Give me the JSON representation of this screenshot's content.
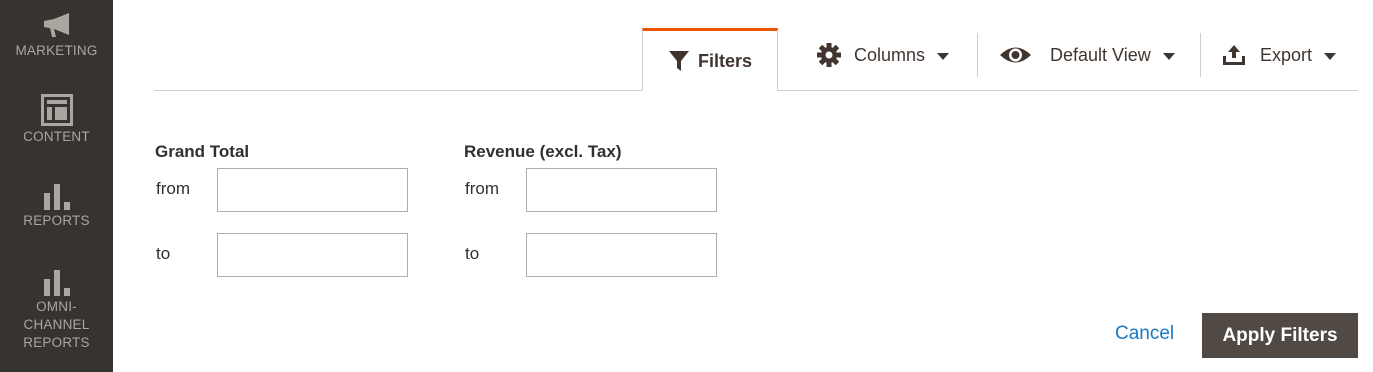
{
  "sidebar": {
    "items": [
      {
        "label": "MARKETING",
        "icon": "megaphone-icon"
      },
      {
        "label": "CONTENT",
        "icon": "content-layout-icon"
      },
      {
        "label": "REPORTS",
        "icon": "bar-chart-icon"
      },
      {
        "label": "OMNI-\nCHANNEL\nREPORTS",
        "icon": "bar-chart-icon"
      }
    ]
  },
  "toolbar": {
    "filters_label": "Filters",
    "columns_label": "Columns",
    "view_label": "Default View",
    "export_label": "Export",
    "active_accent": "#eb5202"
  },
  "filters": {
    "groups": [
      {
        "title": "Grand Total",
        "from_label": "from",
        "to_label": "to",
        "from_value": "",
        "to_value": ""
      },
      {
        "title": "Revenue (excl. Tax)",
        "from_label": "from",
        "to_label": "to",
        "from_value": "",
        "to_value": ""
      }
    ]
  },
  "actions": {
    "cancel_label": "Cancel",
    "apply_label": "Apply Filters"
  },
  "colors": {
    "sidebar_bg": "#373330",
    "link": "#1979c3",
    "primary_button": "#514943"
  }
}
